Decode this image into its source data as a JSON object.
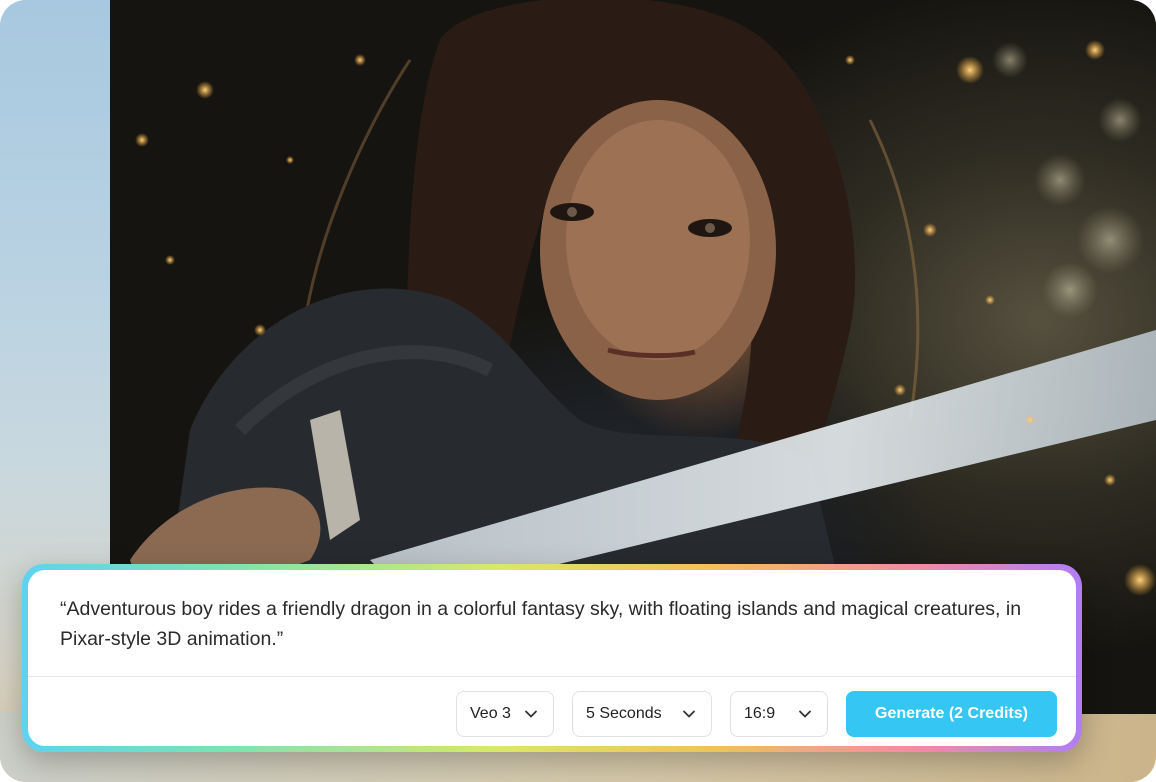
{
  "hero": {
    "image": "warrior-woman-with-sword-photo"
  },
  "prompt": {
    "text": "“Adventurous boy rides a friendly dragon in a colorful fantasy sky, with floating islands and magical creatures, in Pixar-style 3D animation.”"
  },
  "controls": {
    "model": {
      "selected": "Veo 3",
      "icon": "chevron-down-icon"
    },
    "duration": {
      "selected": "5 Seconds",
      "icon": "chevron-down-icon"
    },
    "aspect_ratio": {
      "selected": "16:9",
      "icon": "chevron-down-icon"
    },
    "generate_label": "Generate (2 Credits)"
  },
  "colors": {
    "accent": "#35c6f4",
    "gradient_border": [
      "#5fd2f0",
      "#7ee3b0",
      "#d9e86a",
      "#f3c05a",
      "#f08aa7",
      "#b07ef5"
    ]
  }
}
